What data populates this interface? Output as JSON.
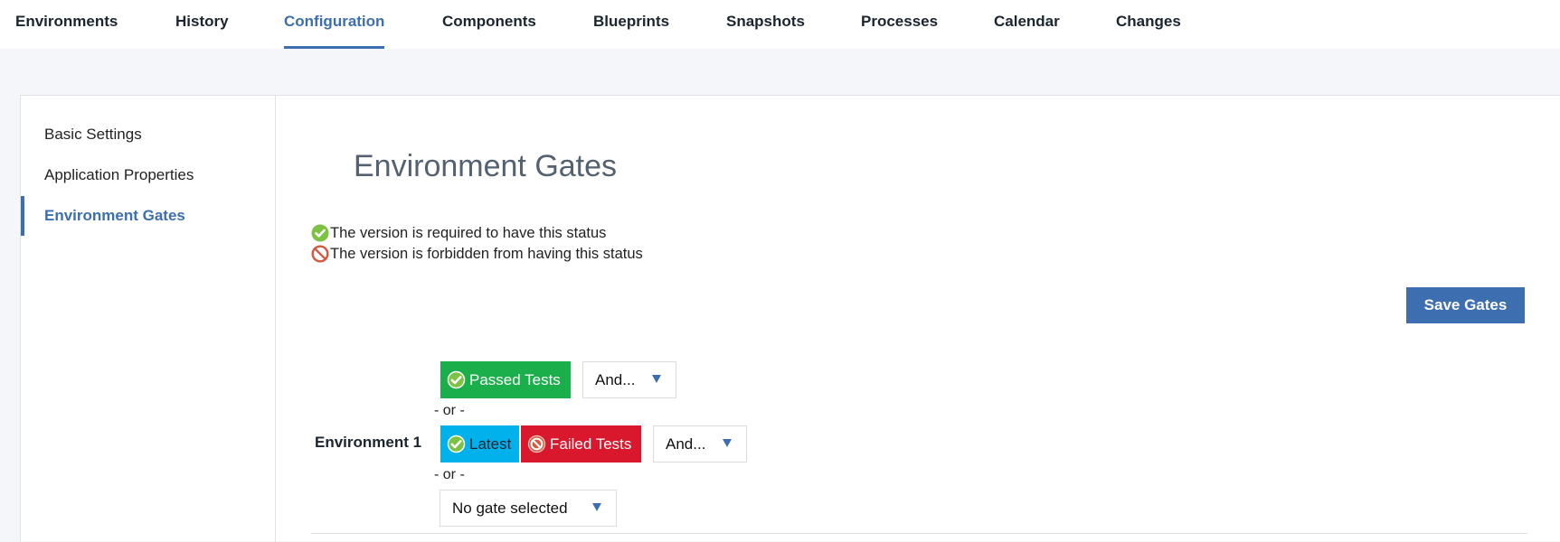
{
  "top_nav": {
    "tabs": [
      {
        "label": "Environments",
        "active": false
      },
      {
        "label": "History",
        "active": false
      },
      {
        "label": "Configuration",
        "active": true
      },
      {
        "label": "Components",
        "active": false
      },
      {
        "label": "Blueprints",
        "active": false
      },
      {
        "label": "Snapshots",
        "active": false
      },
      {
        "label": "Processes",
        "active": false
      },
      {
        "label": "Calendar",
        "active": false
      },
      {
        "label": "Changes",
        "active": false
      }
    ]
  },
  "sidebar": {
    "items": [
      {
        "label": "Basic Settings",
        "active": false
      },
      {
        "label": "Application Properties",
        "active": false
      },
      {
        "label": "Environment Gates",
        "active": true
      }
    ]
  },
  "main": {
    "title": "Environment Gates",
    "legend": [
      {
        "icon": "check-circle-icon",
        "text": "The version is required to have this status"
      },
      {
        "icon": "forbidden-icon",
        "text": "The version is forbidden from having this status"
      }
    ],
    "save_label": "Save Gates",
    "environment": {
      "name": "Environment 1",
      "gate_groups": [
        {
          "conditions": [
            {
              "label": "Passed Tests",
              "type": "required",
              "color": "#1aaf4b"
            }
          ],
          "and_dropdown": "And..."
        },
        {
          "conditions": [
            {
              "label": "Latest",
              "type": "required",
              "color": "#00b1ec"
            },
            {
              "label": "Failed Tests",
              "type": "forbidden",
              "color": "#d9182d"
            }
          ],
          "and_dropdown": "And..."
        }
      ],
      "or_separator": "- or -",
      "new_gate_dropdown": "No gate selected"
    }
  },
  "colors": {
    "accent": "#3d6fb0",
    "required_icon": "#7dc242",
    "forbidden_icon": "#d9573d"
  }
}
